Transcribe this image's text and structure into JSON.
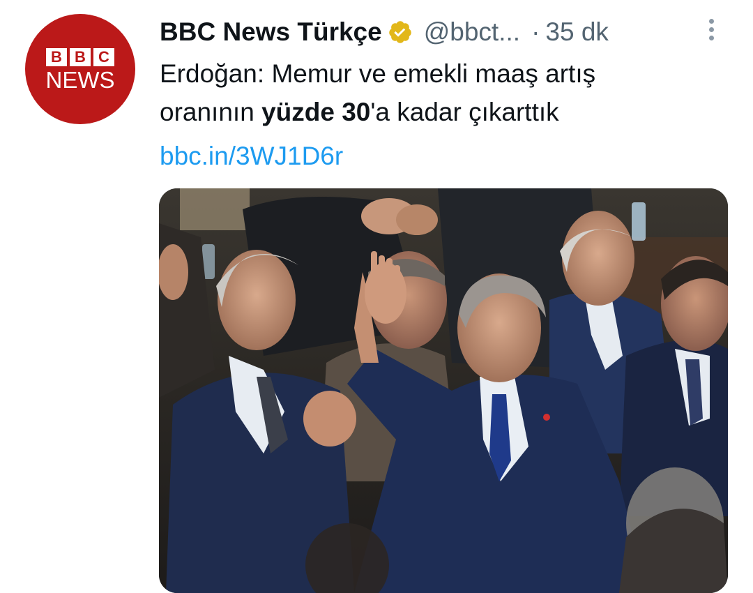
{
  "account": {
    "avatar_top": "BBC",
    "avatar_letters": [
      "B",
      "B",
      "C"
    ],
    "avatar_bottom": "NEWS",
    "display_name": "BBC News Türkçe",
    "handle": "@bbct...",
    "separator": "·",
    "time": "35 dk",
    "verified_icon": "verified-badge-icon",
    "brand_color": "#bb1919",
    "verified_color": "#e2b719"
  },
  "tweet": {
    "line1": "Erdoğan: Memur ve emekli maaş artış",
    "line2_pre": "oranının ",
    "line2_bold": "yüzde 30",
    "line2_post": "'a kadar çıkarttık",
    "link": "bbc.in/3WJ1D6r",
    "link_color": "#1d9bf0"
  },
  "media": {
    "kind": "photo",
    "subject": "photo"
  },
  "menu": {
    "icon": "more-vertical-icon"
  }
}
